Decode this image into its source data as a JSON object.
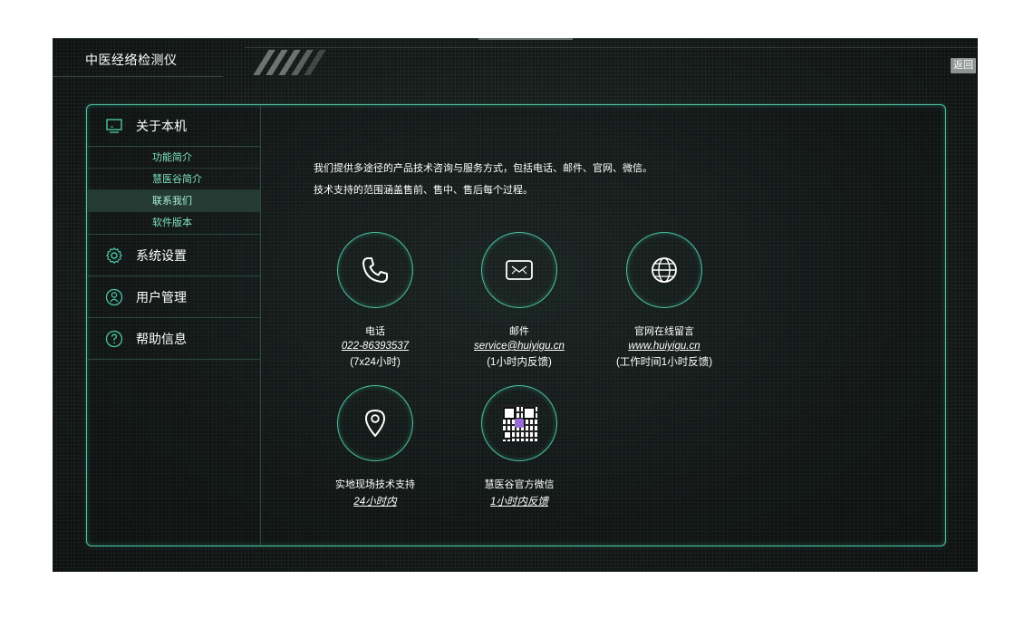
{
  "app": {
    "title": "中医经络检测仪",
    "back_label": "返回"
  },
  "sidebar": {
    "sections": [
      {
        "label": "关于本机",
        "icon": "monitor-icon"
      },
      {
        "label": "系统设置",
        "icon": "gear-icon"
      },
      {
        "label": "用户管理",
        "icon": "user-icon"
      },
      {
        "label": "帮助信息",
        "icon": "help-icon"
      }
    ],
    "sub_items": [
      {
        "label": "功能简介",
        "active": false
      },
      {
        "label": "慧医谷简介",
        "active": false
      },
      {
        "label": "联系我们",
        "active": true
      },
      {
        "label": "软件版本",
        "active": false
      }
    ]
  },
  "content": {
    "intro_line1": "我们提供多途径的产品技术咨询与服务方式，包括电话、邮件、官网、微信。",
    "intro_line2": "技术支持的范围涵盖售前、售中、售后每个过程。",
    "contacts": [
      {
        "label": "电话",
        "link": "022-86393537",
        "note": "(7x24小时)",
        "icon": "phone-icon"
      },
      {
        "label": "邮件",
        "link": "service@huiyigu.cn",
        "note": "(1小时内反馈)",
        "icon": "mail-icon"
      },
      {
        "label": "官网在线留言",
        "link": "www.huiyigu.cn",
        "note": "(工作时间1小时反馈)",
        "icon": "globe-icon"
      },
      {
        "label": "实地现场技术支持",
        "link": "24小时内",
        "note": "",
        "icon": "location-pin-icon"
      },
      {
        "label": "慧医谷官方微信",
        "link": "1小时内反馈",
        "note": "",
        "icon": "qr-code-icon"
      }
    ]
  },
  "colors": {
    "accent": "#4cc4a3",
    "sub_nav_text": "#7fe3c3",
    "active_bg": "#243a33"
  }
}
